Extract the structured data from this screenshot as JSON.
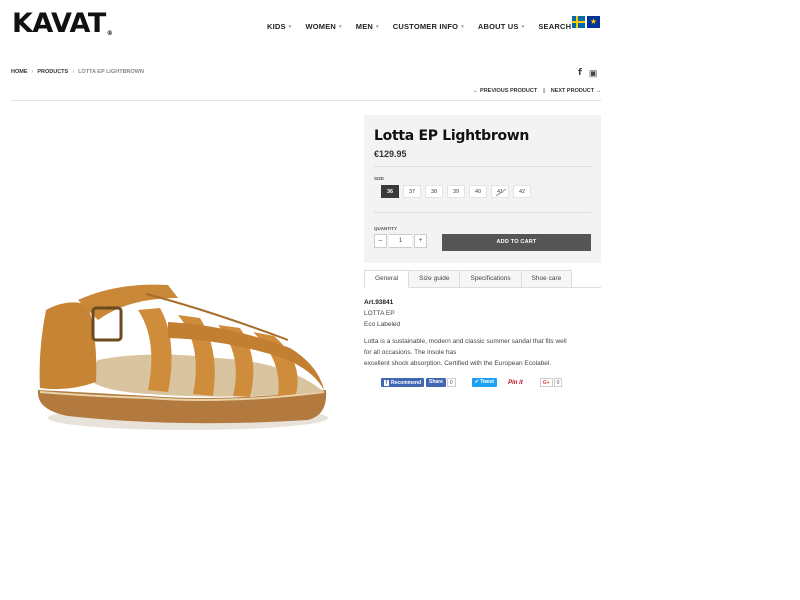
{
  "header": {
    "logo": "KAVAT",
    "logo_mark": "®",
    "nav": [
      {
        "label": "KIDS",
        "has_caret": true
      },
      {
        "label": "WOMEN",
        "has_caret": true
      },
      {
        "label": "MEN",
        "has_caret": true
      },
      {
        "label": "CUSTOMER INFO",
        "has_caret": true
      },
      {
        "label": "ABOUT US",
        "has_caret": true
      },
      {
        "label": "SEARCH",
        "has_caret": false
      }
    ],
    "caret": "▾",
    "flags": [
      "flag-sweden-icon",
      "flag-eu-icon"
    ]
  },
  "breadcrumb": {
    "home": "HOME",
    "products": "PRODUCTS",
    "current": "LOTTA EP LIGHTBROWN",
    "sep": "›"
  },
  "social": {
    "facebook": "f",
    "instagram": "▣"
  },
  "pager": {
    "previous": "← PREVIOUS PRODUCT",
    "divider": "|",
    "next": "NEXT PRODUCT →"
  },
  "product": {
    "title": "Lotta EP Lightbrown",
    "price": "€129.95",
    "size_label": "SIZE",
    "sizes": [
      {
        "label": "36",
        "state": "active"
      },
      {
        "label": "37",
        "state": "available"
      },
      {
        "label": "38",
        "state": "available"
      },
      {
        "label": "39",
        "state": "available"
      },
      {
        "label": "40",
        "state": "available"
      },
      {
        "label": "41",
        "state": "soldout"
      },
      {
        "label": "42",
        "state": "available"
      }
    ],
    "quantity_label": "QUANTITY",
    "quantity": "1",
    "minus": "–",
    "plus": "+",
    "add_to_cart": "ADD TO CART"
  },
  "tabs": [
    "General",
    "Size guide",
    "Specifications",
    "Shoe care"
  ],
  "description": {
    "art": "Art.93841",
    "model": "LOTTA EP",
    "label": "Eco Labeled",
    "text_line1": "Lotta is a sustainable, modern and classic summer sandal that fits well",
    "text_line2": "for all occasions. The insole has",
    "text_line3": "excellent shock absorption. Certified with the European Ecolabel."
  },
  "share": {
    "fb_recommend": "Recommend",
    "fb_share": "Share",
    "fb_count": "0",
    "tweet": "Tweet",
    "pin": "Pin it",
    "gplus": "G+",
    "gplus_count": "0"
  }
}
